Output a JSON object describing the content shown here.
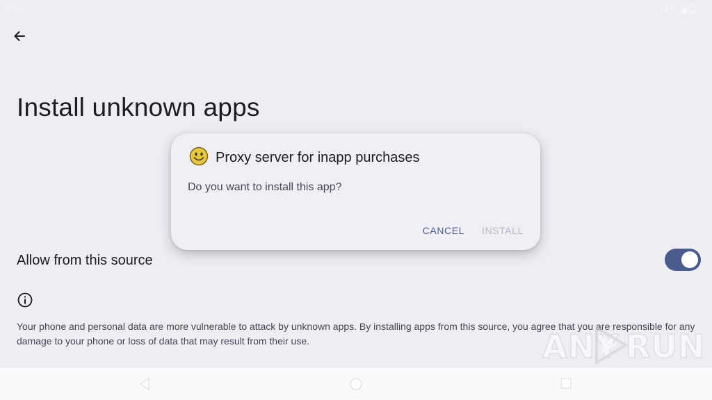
{
  "status_bar": {
    "time": "8:54",
    "network": "LTE"
  },
  "page": {
    "title": "Install unknown apps",
    "allow_label": "Allow from this source",
    "allow_enabled": true,
    "warning": "Your phone and personal data are more vulnerable to attack by unknown apps. By installing apps from this source, you agree that you are responsible for any damage to your phone or loss of data that may result from their use."
  },
  "dialog": {
    "app_name": "Proxy server for inapp purchases",
    "message": "Do you want to install this app?",
    "cancel_label": "CANCEL",
    "install_label": "INSTALL",
    "app_icon": "smiley-face-icon"
  },
  "watermark": {
    "text": "ANY RUN"
  },
  "colors": {
    "accent": "#4a5b8d",
    "background": "#efedf4",
    "dialog": "#f1eff6"
  }
}
